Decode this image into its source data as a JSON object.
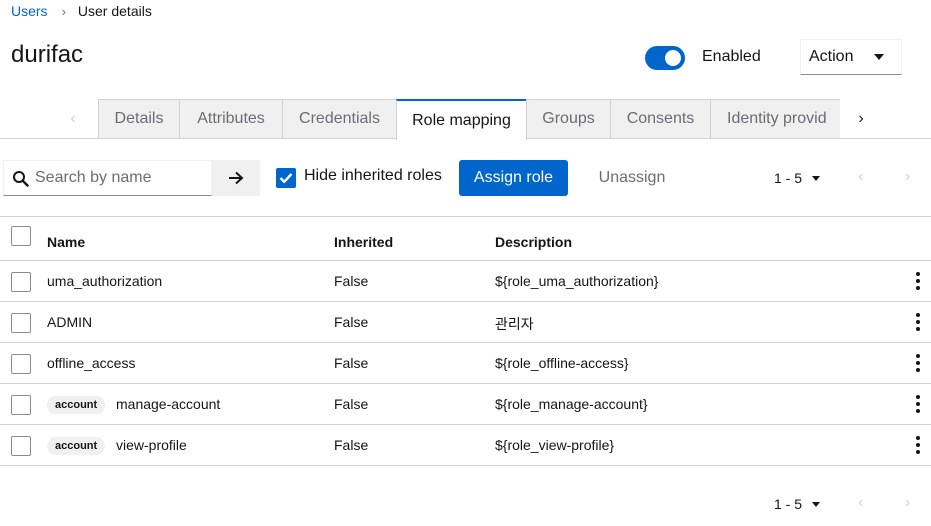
{
  "breadcrumb": {
    "parent": "Users",
    "separator": "›",
    "current": "User details"
  },
  "title": "durifac",
  "status": {
    "enabled_label": "Enabled",
    "enabled": true
  },
  "action_menu": {
    "label": "Action"
  },
  "tabs": {
    "items": [
      {
        "label": "Details"
      },
      {
        "label": "Attributes"
      },
      {
        "label": "Credentials"
      },
      {
        "label": "Role mapping",
        "active": true
      },
      {
        "label": "Groups"
      },
      {
        "label": "Consents"
      },
      {
        "label": "Identity provid"
      }
    ],
    "scroll_left": "‹",
    "scroll_right": "›"
  },
  "toolbar": {
    "search_placeholder": "Search by name",
    "hide_inherited_label": "Hide inherited roles",
    "hide_inherited_checked": true,
    "assign_label": "Assign role",
    "unassign_label": "Unassign",
    "pagination_range": "1 - 5",
    "prev": "‹",
    "next": "›"
  },
  "table": {
    "headers": {
      "name": "Name",
      "inherited": "Inherited",
      "description": "Description"
    },
    "rows": [
      {
        "badge": "",
        "name": "uma_authorization",
        "inherited": "False",
        "description": "${role_uma_authorization}"
      },
      {
        "badge": "",
        "name": "ADMIN",
        "inherited": "False",
        "description": "관리자"
      },
      {
        "badge": "",
        "name": "offline_access",
        "inherited": "False",
        "description": "${role_offline-access}"
      },
      {
        "badge": "account",
        "name": "manage-account",
        "inherited": "False",
        "description": "${role_manage-account}"
      },
      {
        "badge": "account",
        "name": "view-profile",
        "inherited": "False",
        "description": "${role_view-profile}"
      }
    ]
  },
  "footer_pagination": {
    "range": "1 - 5",
    "prev": "‹",
    "next": "›"
  },
  "colors": {
    "primary": "#0066cc",
    "border": "#d2d2d2",
    "muted": "#6a6e73"
  }
}
